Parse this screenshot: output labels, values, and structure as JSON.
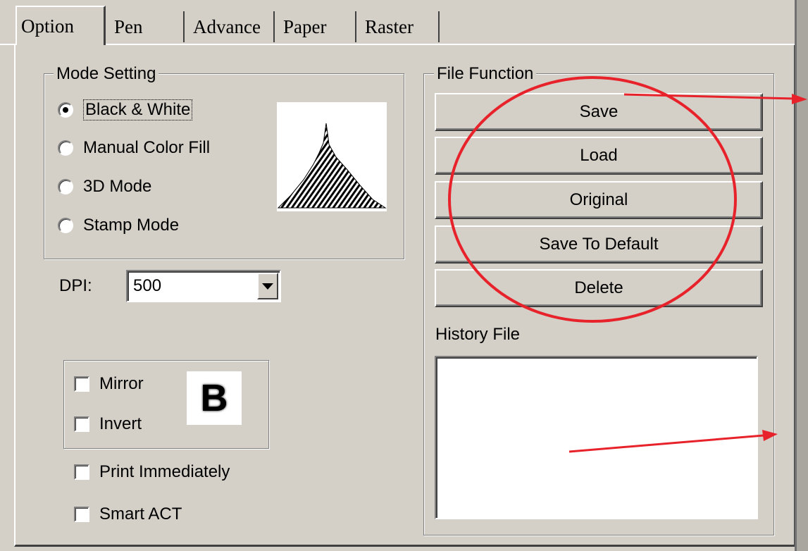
{
  "tabs": [
    {
      "label": "Option",
      "active": true
    },
    {
      "label": "Pen",
      "active": false
    },
    {
      "label": "Advance",
      "active": false
    },
    {
      "label": "Paper",
      "active": false
    },
    {
      "label": "Raster",
      "active": false
    }
  ],
  "mode_setting": {
    "title": "Mode Setting",
    "options": [
      {
        "label": "Black & White",
        "selected": true
      },
      {
        "label": "Manual Color Fill",
        "selected": false
      },
      {
        "label": "3D Mode",
        "selected": false
      },
      {
        "label": "Stamp Mode",
        "selected": false
      }
    ]
  },
  "dpi": {
    "label": "DPI:",
    "value": "500"
  },
  "transform": {
    "mirror_label": "Mirror",
    "invert_label": "Invert",
    "preview_letter": "B"
  },
  "print_immediately_label": "Print Immediately",
  "smart_act_label": "Smart ACT",
  "file_function": {
    "title": "File Function",
    "buttons": [
      "Save",
      "Load",
      "Original",
      "Save To Default",
      "Delete"
    ]
  },
  "history_file": {
    "label": "History File"
  },
  "colors": {
    "window_bg": "#d4d0c8",
    "annotation": "#e8222a"
  }
}
